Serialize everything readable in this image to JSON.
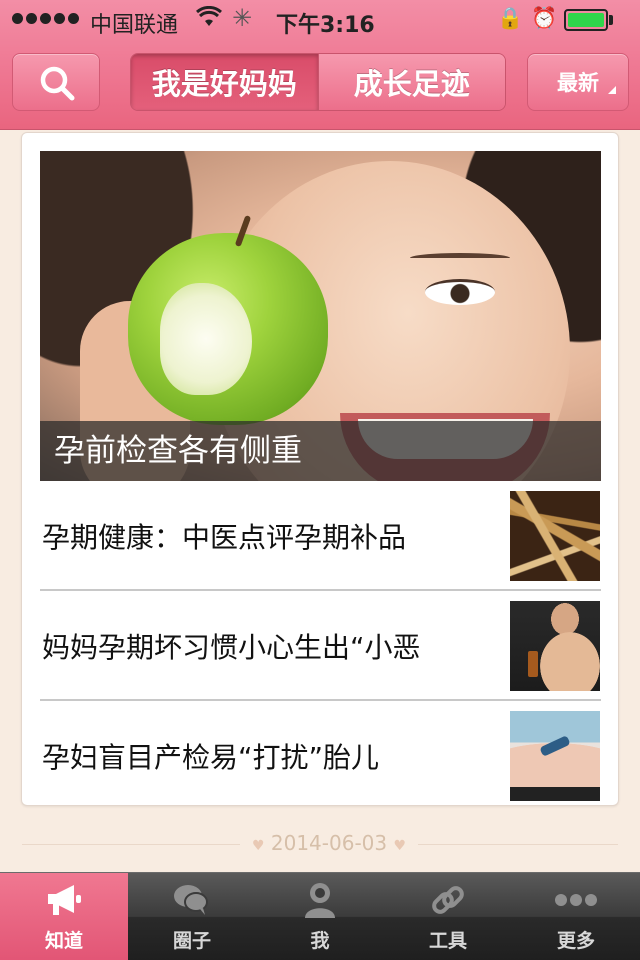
{
  "status_bar": {
    "carrier": "中国联通",
    "time": "下午3:16",
    "battery_level": 1.0,
    "icons": [
      "signal-icon",
      "wifi-icon",
      "activity-spinner-icon",
      "rotation-lock-icon",
      "alarm-icon",
      "battery-icon"
    ]
  },
  "nav": {
    "search_icon": "search-icon",
    "segments": [
      {
        "label": "我是好妈妈",
        "active": true
      },
      {
        "label": "成长足迹",
        "active": false
      }
    ],
    "sort_label": "最新"
  },
  "feature": {
    "caption": "孕前检查各有侧重",
    "image": "woman-with-bitten-green-apple"
  },
  "articles": [
    {
      "title": "孕期健康：中医点评孕期补品",
      "thumb": "ginseng-roots"
    },
    {
      "title": "妈妈孕期坏习惯小心生出“小恶",
      "thumb": "pregnant-woman-smoking"
    },
    {
      "title": "孕妇盲目产检易“打扰”胎儿",
      "thumb": "ultrasound-exam"
    }
  ],
  "date_separator": "2014-06-03",
  "tab_bar": [
    {
      "label": "知道",
      "icon": "megaphone-icon",
      "active": true
    },
    {
      "label": "圈子",
      "icon": "chat-bubbles-icon",
      "active": false
    },
    {
      "label": "我",
      "icon": "person-icon",
      "active": false
    },
    {
      "label": "工具",
      "icon": "link-chain-icon",
      "active": false
    },
    {
      "label": "更多",
      "icon": "more-dots-icon",
      "active": false
    }
  ],
  "colors": {
    "brand_pink": "#ee7590",
    "tab_active": "#e25575",
    "background": "#f8ece1"
  }
}
